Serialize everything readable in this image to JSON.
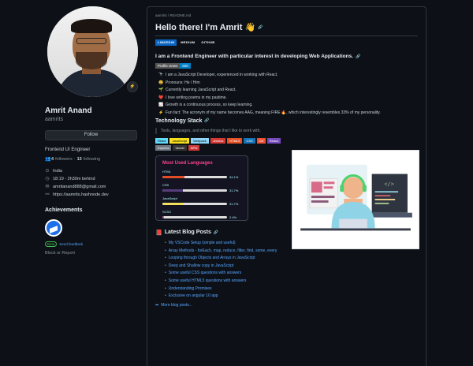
{
  "profile": {
    "fullname": "Amrit Anand",
    "login": "aamrits",
    "status_emoji": "⚡",
    "follow_label": "Follow",
    "bio": "Frontend UI Engineer",
    "followers_count": "4",
    "followers_label": "followers",
    "following_count": "13",
    "following_label": "following",
    "location": "India",
    "local_time": "18:19 - 2h30m behind",
    "email": "amritanand888@gmail.com",
    "website": "https://aamrits.hashnode.dev",
    "achievements_title": "Achievements",
    "beta_label": "Beta",
    "feedback_label": "Send feedback",
    "block_report_label": "Block or Report"
  },
  "readme": {
    "path": "aamrits / README.md",
    "greeting": "Hello there! I'm Amrit 👋",
    "socials": [
      "LINKEDIN",
      "MEDIUM",
      "GITHUB"
    ],
    "intro": "I am a Frontend Engineer with particular interest in developing Web Applications.",
    "views_label": "Profile views",
    "views_value": "600",
    "facts": [
      {
        "icon": "🔭",
        "text": "I am a JavaScript Developer, experienced in working with React."
      },
      {
        "icon": "😄",
        "text": "Pronouns: He / Him"
      },
      {
        "icon": "🌱",
        "text": "Currently learning JavaScript and React."
      },
      {
        "icon": "❤️",
        "text": "I love writing poems in my pastime."
      },
      {
        "icon": "📈",
        "text": "Growth is a continuous process, so keep learning."
      },
      {
        "icon": "⚡",
        "text": "Fun fact: The acronym of my name becomes AAG, meaning FIRE 🔥, which interestingly resembles 33% of my personality."
      }
    ],
    "tech_title": "Technology Stack",
    "tools_quote": "Tools, languages, and other things that I like to work with.",
    "skills": [
      {
        "label": "React",
        "color": "#61dafb"
      },
      {
        "label": "JavaScript",
        "color": "#f7df1e"
      },
      {
        "label": "Webpack",
        "color": "#8dd6f9"
      },
      {
        "label": "Jenkins",
        "color": "#d33833"
      },
      {
        "label": "HTML5",
        "color": "#e34f26"
      },
      {
        "label": "CSS",
        "color": "#1572b6"
      },
      {
        "label": "Git",
        "color": "#f05032"
      },
      {
        "label": "Redux",
        "color": "#764abc"
      },
      {
        "label": "Express",
        "color": "#6e7681"
      },
      {
        "label": "Vercel",
        "color": "#333333"
      },
      {
        "label": "NPM",
        "color": "#cb3837"
      }
    ],
    "langs_title": "Most Used Languages",
    "languages": [
      {
        "name": "HTML",
        "pct": "34.1%",
        "value": 34.1,
        "color": "#e34c26"
      },
      {
        "name": "CSS",
        "pct": "31.7%",
        "value": 31.7,
        "color": "#563d7c"
      },
      {
        "name": "JavaScript",
        "pct": "31.7%",
        "value": 31.7,
        "color": "#f1e05a"
      },
      {
        "name": "SCSS",
        "pct": "2.4%",
        "value": 2.4,
        "color": "#c6538c"
      }
    ],
    "blog_title": "Latest Blog Posts",
    "blog_icon": "📕",
    "posts": [
      "My VSCode Setup (simple and useful)",
      "Array Methods - forEach, map, reduce, filter, find, some, every",
      "Looping through Objects and Arrays in JavaScript",
      "Deep and Shallow copy in JavaScript",
      "Some useful CSS questions with answers",
      "Some useful HTML5 questions with answers",
      "Understanding Promises",
      "Exclusive on angular 10 app"
    ],
    "more_label": "More blog posts..."
  }
}
